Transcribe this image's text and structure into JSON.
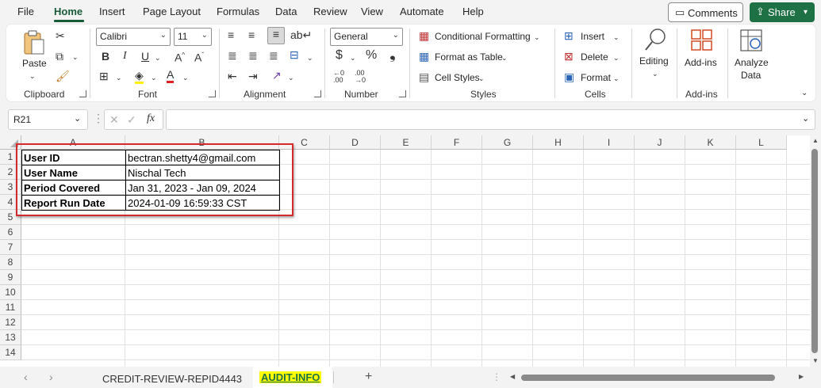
{
  "menu": {
    "items": [
      "File",
      "Home",
      "Insert",
      "Page Layout",
      "Formulas",
      "Data",
      "Review",
      "View",
      "Automate",
      "Help"
    ],
    "active": "Home",
    "comments_label": "Comments",
    "share_label": "Share"
  },
  "ribbon": {
    "clipboard": {
      "label": "Clipboard",
      "paste_label": "Paste"
    },
    "font": {
      "label": "Font",
      "font_name": "Calibri",
      "font_size": "11"
    },
    "alignment": {
      "label": "Alignment"
    },
    "number": {
      "label": "Number",
      "format": "General"
    },
    "styles": {
      "label": "Styles",
      "conditional_formatting": "Conditional Formatting",
      "format_as_table": "Format as Table",
      "cell_styles": "Cell Styles"
    },
    "cells": {
      "label": "Cells",
      "insert": "Insert",
      "delete": "Delete",
      "format": "Format"
    },
    "editing": {
      "label": "Editing"
    },
    "addins": {
      "label": "Add-ins",
      "button_label": "Add-ins"
    },
    "analyze": {
      "label_line1": "Analyze",
      "label_line2": "Data"
    }
  },
  "formula_bar": {
    "name_box": "R21",
    "formula": "",
    "fx_label": "fx"
  },
  "grid": {
    "columns": [
      "A",
      "B",
      "C",
      "D",
      "E",
      "F",
      "G",
      "H",
      "I",
      "J",
      "K",
      "L"
    ],
    "rows": [
      "1",
      "2",
      "3",
      "4",
      "5",
      "6",
      "7",
      "8",
      "9",
      "10",
      "11",
      "12",
      "13",
      "14"
    ],
    "cells": [
      {
        "label": "User ID",
        "value": "bectran.shetty4@gmail.com"
      },
      {
        "label": "User Name",
        "value": "Nischal Tech"
      },
      {
        "label": "Period Covered",
        "value": "Jan 31, 2023 - Jan 09, 2024"
      },
      {
        "label": "Report Run Date",
        "value": "2024-01-09 16:59:33 CST"
      }
    ],
    "highlight_color": "#d52a2a"
  },
  "sheet_tabs": {
    "tabs": [
      "CREDIT-REVIEW-REPID4443",
      "AUDIT-INFO"
    ],
    "active": "AUDIT-INFO",
    "add_label": "+"
  },
  "colors": {
    "accent": "#185c37",
    "share_bg": "#1e7145",
    "active_tab_bg": "#ffff00"
  }
}
